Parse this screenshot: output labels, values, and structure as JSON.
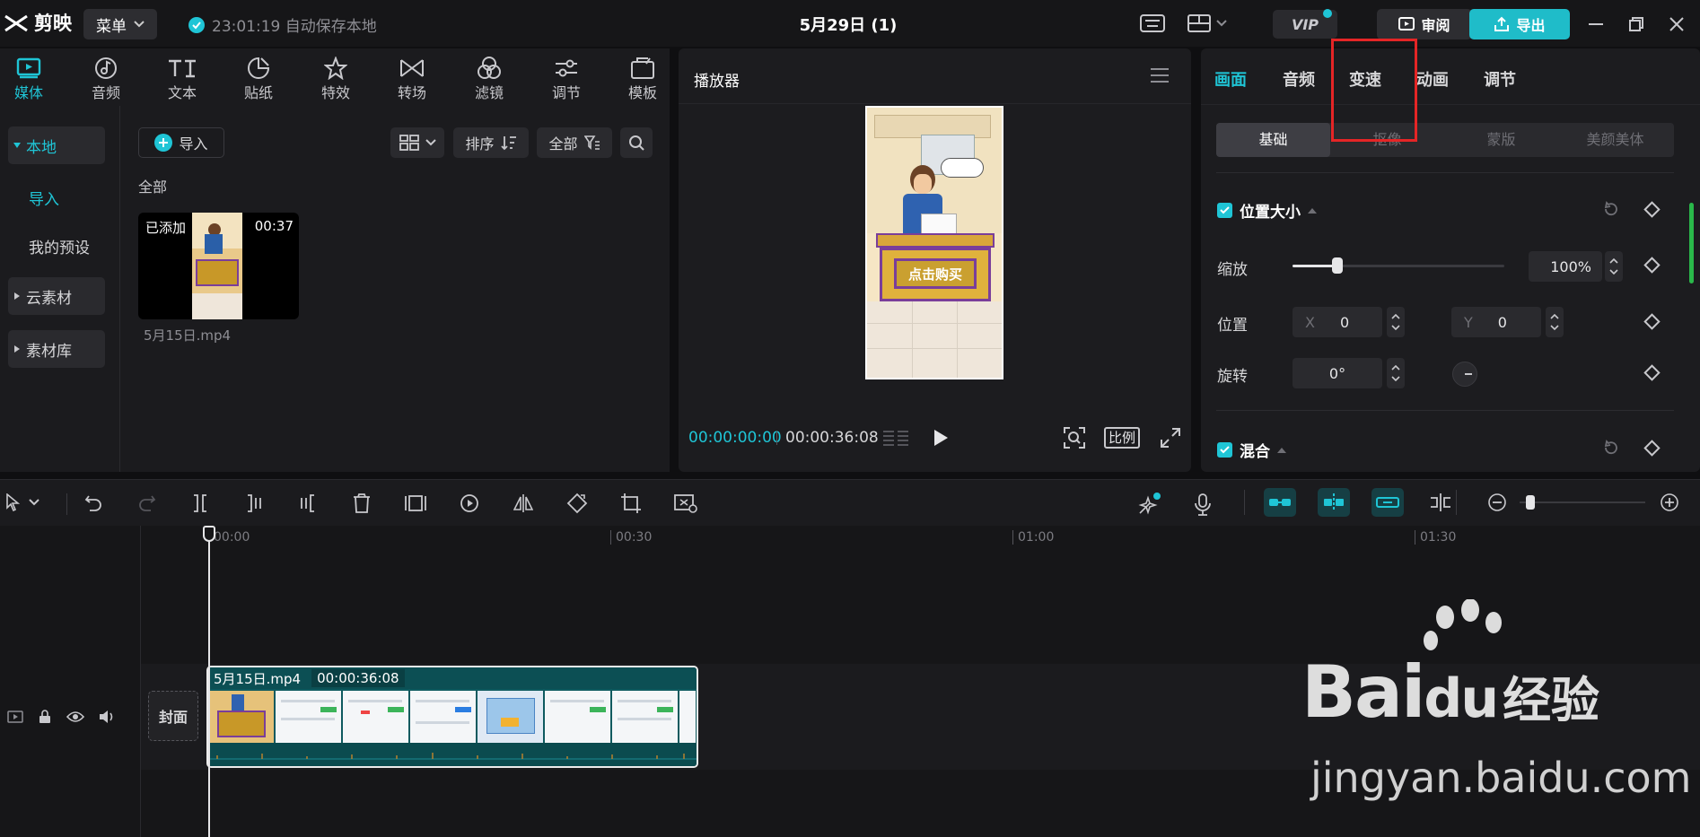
{
  "app": {
    "logo_text": "剪映",
    "menu_label": "菜单",
    "autosave": "23:01:19 自动保存本地",
    "project_title": "5月29日 (1)",
    "vip_label": "VIP",
    "review_label": "审阅",
    "export_label": "导出",
    "accent_color": "#1fc5d6"
  },
  "media_tabs": [
    {
      "label": "媒体",
      "icon": "media-icon"
    },
    {
      "label": "音频",
      "icon": "audio-icon"
    },
    {
      "label": "文本",
      "icon": "text-icon"
    },
    {
      "label": "贴纸",
      "icon": "sticker-icon"
    },
    {
      "label": "特效",
      "icon": "effects-icon"
    },
    {
      "label": "转场",
      "icon": "transition-icon"
    },
    {
      "label": "滤镜",
      "icon": "filter-icon"
    },
    {
      "label": "调节",
      "icon": "adjust-icon"
    },
    {
      "label": "模板",
      "icon": "template-icon"
    }
  ],
  "side_nav": {
    "local": "本地",
    "import": "导入",
    "my_presets": "我的预设",
    "cloud": "云素材",
    "library": "素材库"
  },
  "media": {
    "import_button": "导入",
    "sort_label": "排序",
    "filter_label": "全部",
    "section_label": "全部",
    "clip": {
      "badge": "已添加",
      "duration": "00:37",
      "filename": "5月15日.mp4"
    }
  },
  "player": {
    "title": "播放器",
    "current_time": "00:00:00:00",
    "total_time": "00:00:36:08",
    "ratio_label": "比例",
    "preview_button_text": "点击购买"
  },
  "props": {
    "tabs": [
      "画面",
      "音频",
      "变速",
      "动画",
      "调节"
    ],
    "sub_tabs": [
      "基础",
      "抠像",
      "蒙版",
      "美颜美体"
    ],
    "section_position": "位置大小",
    "scale_label": "缩放",
    "scale_value": "100%",
    "scale_fraction": 0.21,
    "position_label": "位置",
    "x_label": "X",
    "x_value": "0",
    "y_label": "Y",
    "y_value": "0",
    "rotate_label": "旋转",
    "rotate_value": "0°",
    "section_blend": "混合"
  },
  "timeline": {
    "ruler": [
      "00:00",
      "00:30",
      "01:00",
      "01:30"
    ],
    "cover_label": "封面",
    "clip_name": "5月15日.mp4",
    "clip_duration": "00:00:36:08",
    "zoom_fraction": 0.05
  },
  "watermark": {
    "brand": "Bai",
    "brand_du": "du",
    "brand_cn": "经验",
    "url": "jingyan.baidu.com"
  }
}
